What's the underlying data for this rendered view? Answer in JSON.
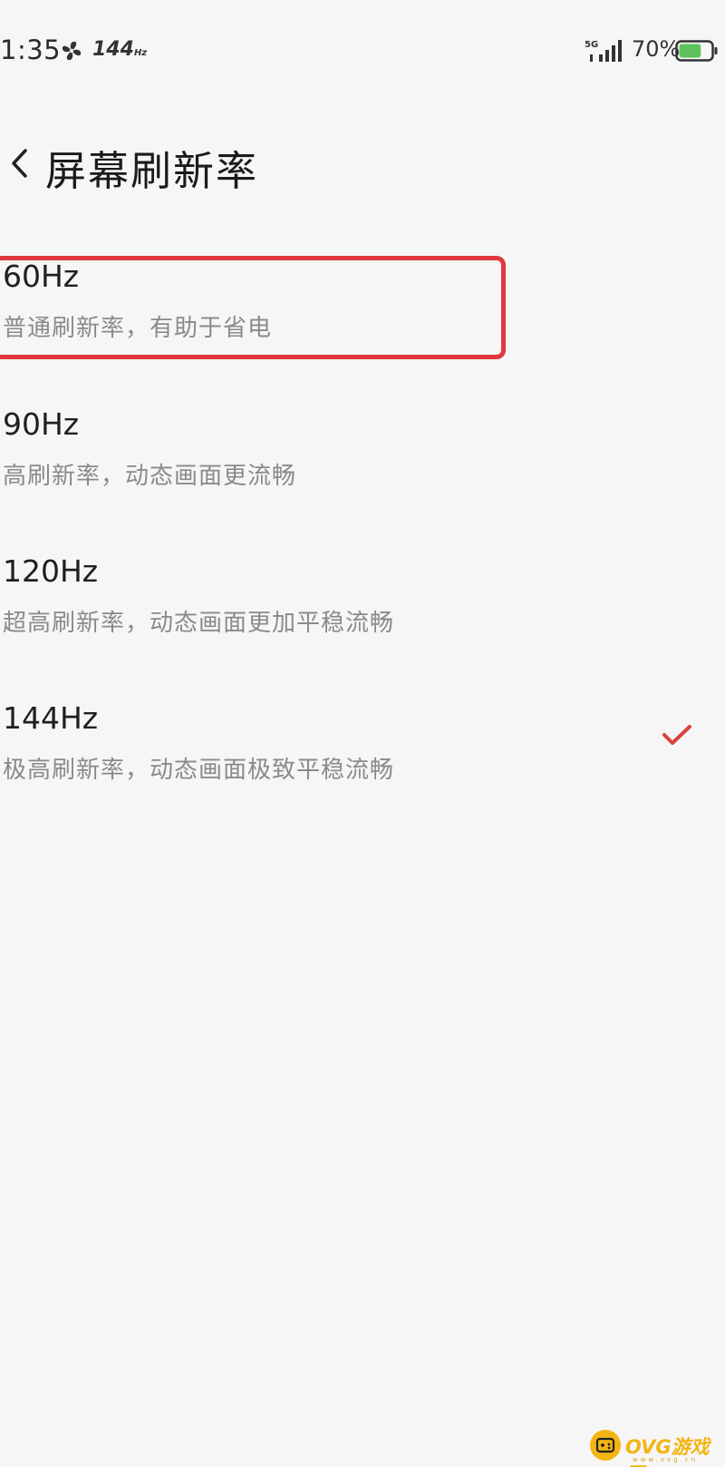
{
  "status_bar": {
    "time": "1:35",
    "refresh_rate": "144",
    "refresh_unit": "Hz",
    "network_label": "5G",
    "battery_text": "70%",
    "battery_level": 0.7,
    "battery_color": "#5cc15a"
  },
  "header": {
    "back_icon": "chevron-left-icon",
    "title": "屏幕刷新率"
  },
  "options": [
    {
      "label": "60Hz",
      "description": "普通刷新率，有助于省电",
      "selected": false,
      "highlighted": true
    },
    {
      "label": "90Hz",
      "description": "高刷新率，动态画面更流畅",
      "selected": false,
      "highlighted": false
    },
    {
      "label": "120Hz",
      "description": "超高刷新率，动态画面更加平稳流畅",
      "selected": false,
      "highlighted": false
    },
    {
      "label": "144Hz",
      "description": "极高刷新率，动态画面极致平稳流畅",
      "selected": true,
      "highlighted": false
    }
  ],
  "colors": {
    "check": "#d9433f",
    "highlight": "#e0383e",
    "watermark": "#f3b512"
  },
  "watermark": {
    "text": "OVG游戏网",
    "sub": "www.ovg.cn"
  }
}
